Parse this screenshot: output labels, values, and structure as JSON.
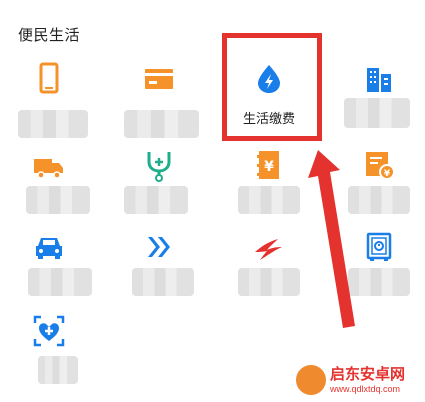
{
  "section": {
    "title": "便民生活"
  },
  "tiles": [
    {
      "id": "phone",
      "label": "",
      "icon": "phone-icon",
      "color": "#f5922a"
    },
    {
      "id": "card",
      "label": "",
      "icon": "card-icon",
      "color": "#f5922a"
    },
    {
      "id": "utility",
      "label": "生活缴费",
      "icon": "water-drop-icon",
      "color": "#1a7ee8"
    },
    {
      "id": "building",
      "label": "",
      "icon": "building-icon",
      "color": "#1a7ee8"
    },
    {
      "id": "truck",
      "label": "",
      "icon": "truck-icon",
      "color": "#f5922a"
    },
    {
      "id": "stethoscope",
      "label": "",
      "icon": "stethoscope-icon",
      "color": "#1fae8c"
    },
    {
      "id": "money",
      "label": "",
      "icon": "yuan-book-icon",
      "color": "#f5922a"
    },
    {
      "id": "invoice",
      "label": "",
      "icon": "invoice-icon",
      "color": "#f5922a"
    },
    {
      "id": "car",
      "label": "",
      "icon": "car-icon",
      "color": "#1a7ee8"
    },
    {
      "id": "chevrons",
      "label": "",
      "icon": "double-chevron-icon",
      "color": "#1a7ee8"
    },
    {
      "id": "bird",
      "label": "",
      "icon": "airline-bird-icon",
      "color": "#e4332f"
    },
    {
      "id": "safe",
      "label": "",
      "icon": "safe-icon",
      "color": "#1a7ee8"
    },
    {
      "id": "health",
      "label": "",
      "icon": "health-heart-icon",
      "color": "#1a7ee8"
    }
  ],
  "watermark": {
    "name": "启东安卓网",
    "url": "www.qdlxtdq.com"
  }
}
